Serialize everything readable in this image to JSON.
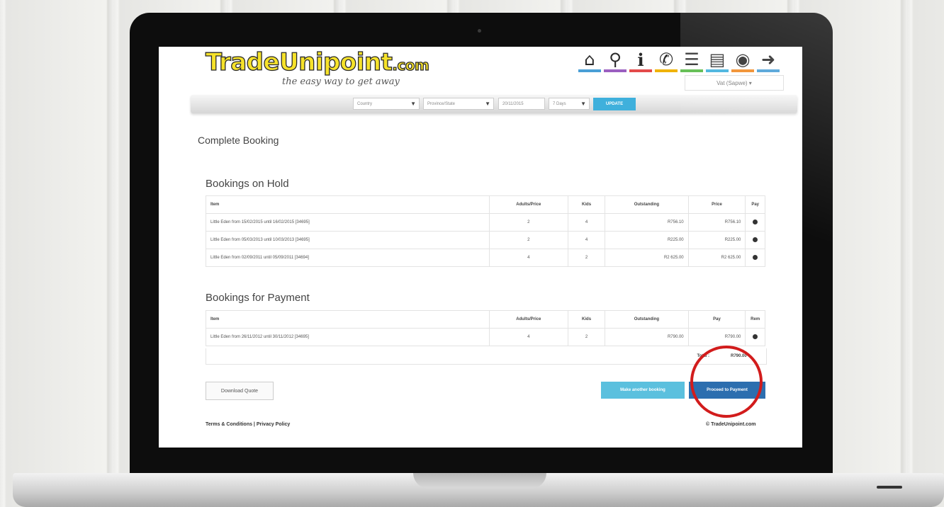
{
  "site": {
    "logo_text": "TradeUnipoint",
    "logo_tld": ".com",
    "tagline": "the easy way to get away"
  },
  "nav_icons": [
    "home-icon",
    "search-icon",
    "info-icon",
    "phone-icon",
    "menu-icon",
    "cart-icon",
    "location-icon",
    "login-icon"
  ],
  "currency_selector": {
    "value": "Vat (Sapwe) ▾"
  },
  "search": {
    "country": "Country",
    "province": "Province/State",
    "date": "20/11/2015",
    "nights": "7 Days",
    "update_label": "UPDATE"
  },
  "page_title": "Complete Booking",
  "on_hold": {
    "title": "Bookings on Hold",
    "columns": [
      "Item",
      "Adults/Price",
      "Kids",
      "Outstanding",
      "Price",
      "Pay"
    ],
    "rows": [
      {
        "item": "Little Eden from 15/02/2015 until 16/02/2015 [34695]",
        "adults": "2",
        "kids": "4",
        "outstanding": "R756.10",
        "price": "R756.10"
      },
      {
        "item": "Little Eden from 05/03/2013 until 10/03/2013 [34695]",
        "adults": "2",
        "kids": "4",
        "outstanding": "R225.00",
        "price": "R225.00"
      },
      {
        "item": "Little Eden from 02/09/2011 until 05/09/2011 [34694]",
        "adults": "4",
        "kids": "2",
        "outstanding": "R2 625.00",
        "price": "R2 625.00"
      }
    ]
  },
  "for_payment": {
    "title": "Bookings for Payment",
    "columns": [
      "Item",
      "Adults/Price",
      "Kids",
      "Outstanding",
      "Pay",
      "Rem"
    ],
    "rows": [
      {
        "item": "Little Eden from 26/11/2012 until 30/11/2012 [34695]",
        "adults": "4",
        "kids": "2",
        "outstanding": "R790.00",
        "pay": "R790.00"
      }
    ],
    "total_label": "Total :",
    "total_value": "R790.00"
  },
  "buttons": {
    "download": "Download Quote",
    "another": "Make another booking",
    "proceed": "Proceed to Payment"
  },
  "footer": {
    "links": "Terms & Conditions | Privacy Policy",
    "copyright": "© TradeUnipoint.com"
  },
  "colors": {
    "logo_yellow": "#f6e22a",
    "update_blue": "#3fb0dc",
    "another_button": "#5bc0de",
    "proceed_button": "#2c6eaf",
    "highlight_circle": "#d21c1c"
  }
}
